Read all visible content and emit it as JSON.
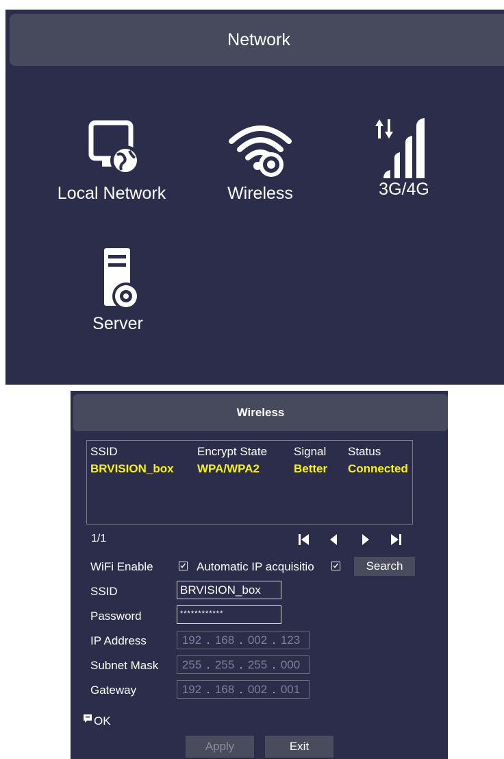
{
  "network": {
    "title": "Network",
    "items": [
      {
        "label": "Local Network",
        "icon": "monitor-globe-icon"
      },
      {
        "label": "Wireless",
        "icon": "wifi-gear-icon"
      },
      {
        "label": "3G/4G",
        "icon": "cellular-signal-icon"
      },
      {
        "label": "Server",
        "icon": "server-gear-icon"
      }
    ]
  },
  "wireless": {
    "title": "Wireless",
    "table": {
      "columns": [
        "SSID",
        "Encrypt State",
        "Signal",
        "Status"
      ],
      "rows": [
        {
          "ssid": "BRVISION_box",
          "encrypt": "WPA/WPA2",
          "signal": "Better",
          "status": "Connected"
        }
      ]
    },
    "page_indicator": "1/1",
    "pager_icons": [
      "first-page-icon",
      "prev-page-icon",
      "next-page-icon",
      "last-page-icon"
    ],
    "wifi_enable_label": "WiFi Enable",
    "wifi_enable_checked": true,
    "auto_ip_label": "Automatic IP acquisitio",
    "auto_ip_checked": true,
    "search_label": "Search",
    "ssid_label": "SSID",
    "ssid_value": "BRVISION_box",
    "password_label": "Password",
    "password_value": "************",
    "ip_label": "IP Address",
    "ip_segments": [
      "192",
      "168",
      "002",
      "123"
    ],
    "subnet_label": "Subnet Mask",
    "subnet_segments": [
      "255",
      "255",
      "255",
      "000"
    ],
    "gateway_label": "Gateway",
    "gateway_segments": [
      "192",
      "168",
      "002",
      "001"
    ],
    "ip_separator": ".",
    "status_icon": "message-icon",
    "status_text": "OK",
    "apply_label": "Apply",
    "exit_label": "Exit"
  },
  "colors": {
    "panel_bg": "#2b2d4b",
    "header_bg": "#474a5d",
    "highlight_text": "#f7f218",
    "disabled_text": "#8b8c98"
  }
}
